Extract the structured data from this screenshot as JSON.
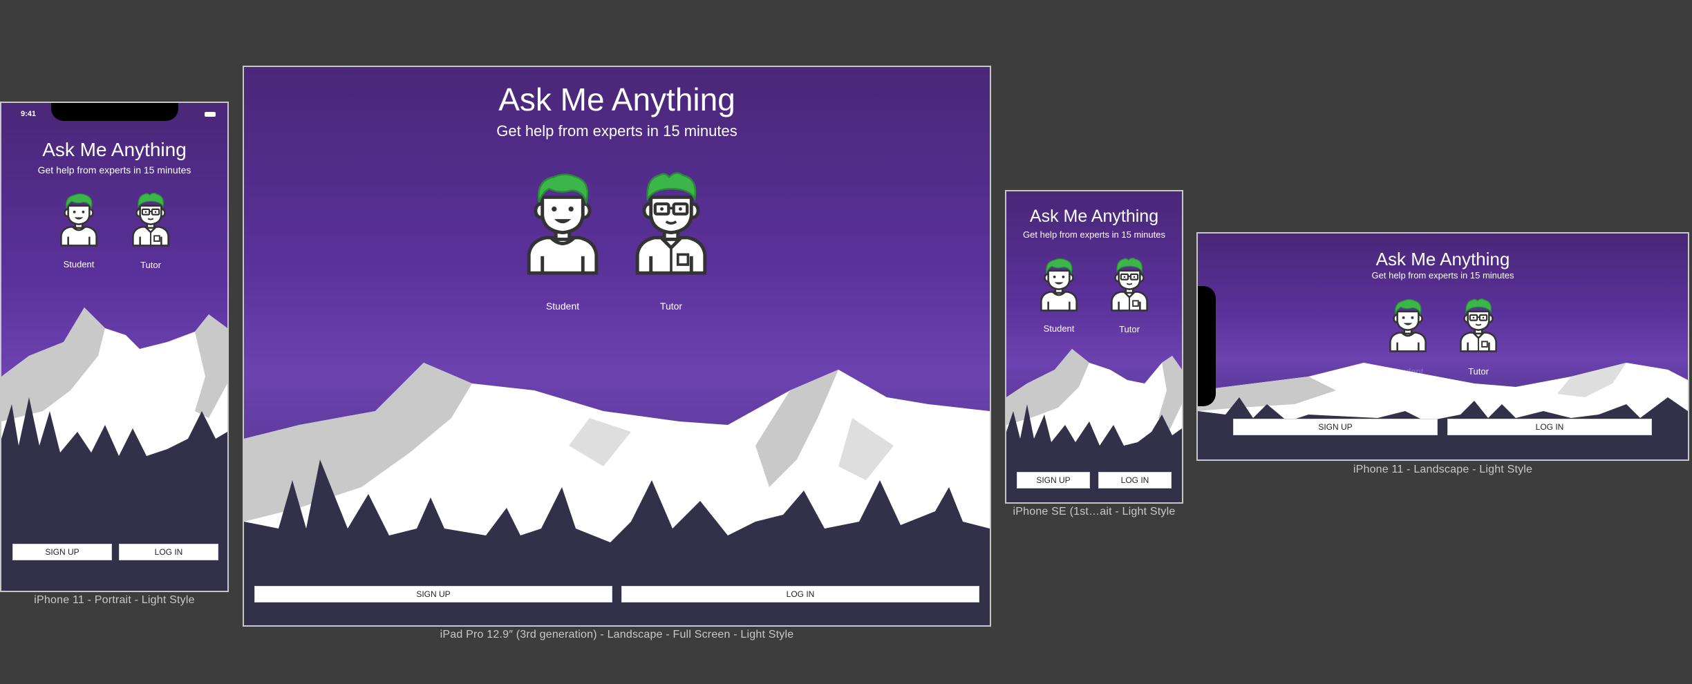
{
  "app": {
    "title": "Ask Me Anything",
    "subtitle": "Get help from experts in 15 minutes",
    "student_label": "Student",
    "tutor_label": "Tutor",
    "signup_label": "SIGN UP",
    "login_label": "LOG IN"
  },
  "status_bar": {
    "time": "9:41"
  },
  "captions": {
    "iphone11_portrait": "iPhone 11 - Portrait - Light Style",
    "ipad_pro": "iPad Pro 12.9″ (3rd generation) - Landscape - Full Screen - Light Style",
    "iphone_se": "iPhone SE (1st…ait - Light Style",
    "iphone11_landscape": "iPhone 11 - Landscape - Light Style"
  },
  "colors": {
    "canvas_bg": "#3d3d3d",
    "purple_top": "#4a2778",
    "purple_mid": "#6c42b0",
    "ground": "#33304a",
    "hair_green": "#3cb54a",
    "snow": "#ffffff",
    "rock_shade": "#c9c9c9"
  },
  "icons": {
    "student": "student-avatar-icon",
    "tutor": "tutor-avatar-icon"
  }
}
